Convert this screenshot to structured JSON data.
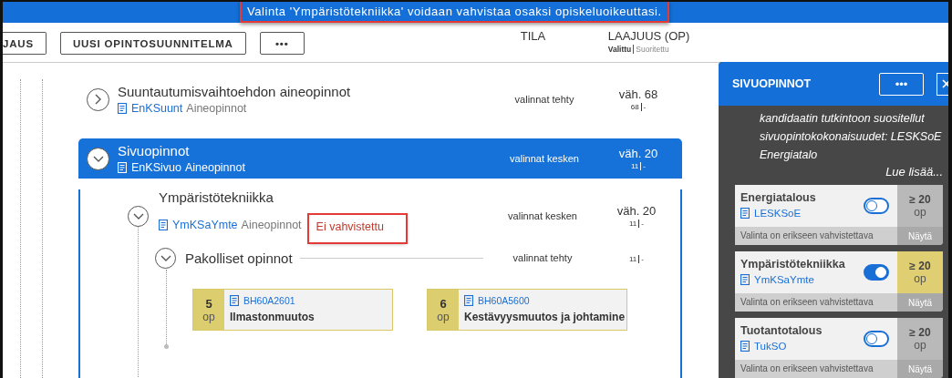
{
  "notification": {
    "text": "Valinta 'Ympäristötekniikka' voidaan vahvistaa osaksi opiskeluoikeuttasi.",
    "highlighted": true
  },
  "toolbar": [
    {
      "label": "JAUS",
      "kind": "cut"
    },
    {
      "label": "UUSI OPINTOSUUNNITELMA",
      "kind": "text"
    },
    {
      "label": "•••",
      "kind": "more"
    }
  ],
  "columns": {
    "status": "TILA",
    "credits": "LAAJUUS (OP)",
    "selected": "Valittu",
    "completed": "Suoritettu"
  },
  "modules": [
    {
      "name": "Suuntautumisvaihtoehdon aineopinnot",
      "code": "EnKSuunt",
      "type": "Aineopinnot",
      "status": "valinnat tehty",
      "credits": "väh. 68",
      "credits_selected": "68",
      "credits_completed": "-",
      "expanded": false,
      "selected": false
    },
    {
      "name": "Sivuopinnot",
      "code": "EnKSivuo",
      "type": "Aineopinnot",
      "status": "valinnat kesken",
      "credits": "väh. 20",
      "credits_selected": "11",
      "credits_completed": "-",
      "expanded": true,
      "selected": true,
      "children": [
        {
          "name": "Ympäristötekniikka",
          "code": "YmKSaYmte",
          "type": "Aineopinnot",
          "warning": "Ei vahvistettu",
          "warning_highlighted": true,
          "status": "valinnat kesken",
          "credits": "väh. 20",
          "credits_selected": "11",
          "credits_completed": "-",
          "expanded": true,
          "children": [
            {
              "name": "Pakolliset opinnot",
              "status": "valinnat tehty",
              "credits_selected": "11",
              "credits_completed": "-",
              "expanded": true,
              "courses": [
                {
                  "credits": "5",
                  "unit": "op",
                  "code": "BH60A2601",
                  "name": "Ilmastonmuutos"
                },
                {
                  "credits": "6",
                  "unit": "op",
                  "code": "BH60A5600",
                  "name": "Kestävyysmuutos ja johtamine"
                }
              ]
            }
          ]
        }
      ]
    }
  ],
  "side_panel": {
    "title": "SIVUOPINNOT",
    "more": "•••",
    "description": "kandidaatin tutkintoon suositellut sivuopintokokonaisuudet: LESKSoE Energiatalo",
    "read_more": "Lue lisää...",
    "options": [
      {
        "name": "Energiatalous",
        "code": "LESKSoE",
        "on": false,
        "credits": "≥ 20",
        "unit": "op",
        "note": "Valinta on erikseen vahvistettava",
        "action": "Näytä"
      },
      {
        "name": "Ympäristötekniikka",
        "code": "YmKSaYmte",
        "on": true,
        "credits": "≥ 20",
        "unit": "op",
        "note": "Valinta on erikseen vahvistettava",
        "action": "Näytä"
      },
      {
        "name": "Tuotantotalous",
        "code": "TukSO",
        "on": false,
        "credits": "≥ 20",
        "unit": "op",
        "note": "Valinta on erikseen vahvistettava",
        "action": "Näytä"
      }
    ]
  }
}
